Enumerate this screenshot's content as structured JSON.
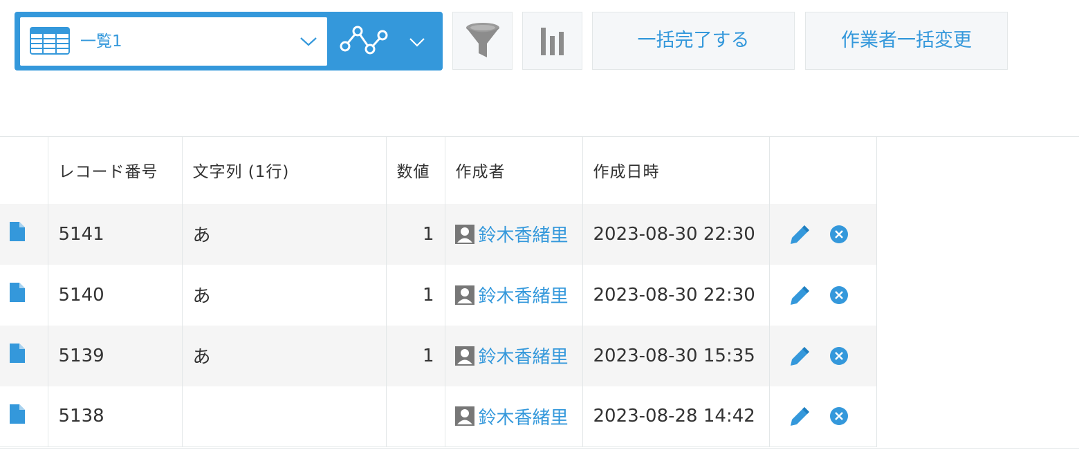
{
  "toolbar": {
    "view_name": "一覧1",
    "bulk_complete_label": "一括完了する",
    "bulk_assign_label": "作業者一括変更"
  },
  "table": {
    "headers": {
      "record_number": "レコード番号",
      "text_single_line": "文字列 (1行)",
      "number": "数値",
      "created_by": "作成者",
      "created_datetime": "作成日時"
    },
    "rows": [
      {
        "record_number": "5141",
        "text": "あ",
        "number": "1",
        "created_by": "鈴木香緒里",
        "created_datetime": "2023-08-30 22:30"
      },
      {
        "record_number": "5140",
        "text": "あ",
        "number": "1",
        "created_by": "鈴木香緒里",
        "created_datetime": "2023-08-30 22:30"
      },
      {
        "record_number": "5139",
        "text": "あ",
        "number": "1",
        "created_by": "鈴木香緒里",
        "created_datetime": "2023-08-30 15:35"
      },
      {
        "record_number": "5138",
        "text": "",
        "number": "",
        "created_by": "鈴木香緒里",
        "created_datetime": "2023-08-28 14:42"
      }
    ]
  },
  "icons": {
    "view": "table-icon",
    "graph": "line-graph-icon",
    "filter": "funnel-icon",
    "chart": "bar-chart-icon",
    "detail": "document-icon",
    "user": "user-icon",
    "edit": "pencil-icon",
    "delete": "close-circle-icon"
  },
  "colors": {
    "accent": "#3498db",
    "icon_gray": "#8c8c8c",
    "row_alt": "#f5f5f5"
  }
}
